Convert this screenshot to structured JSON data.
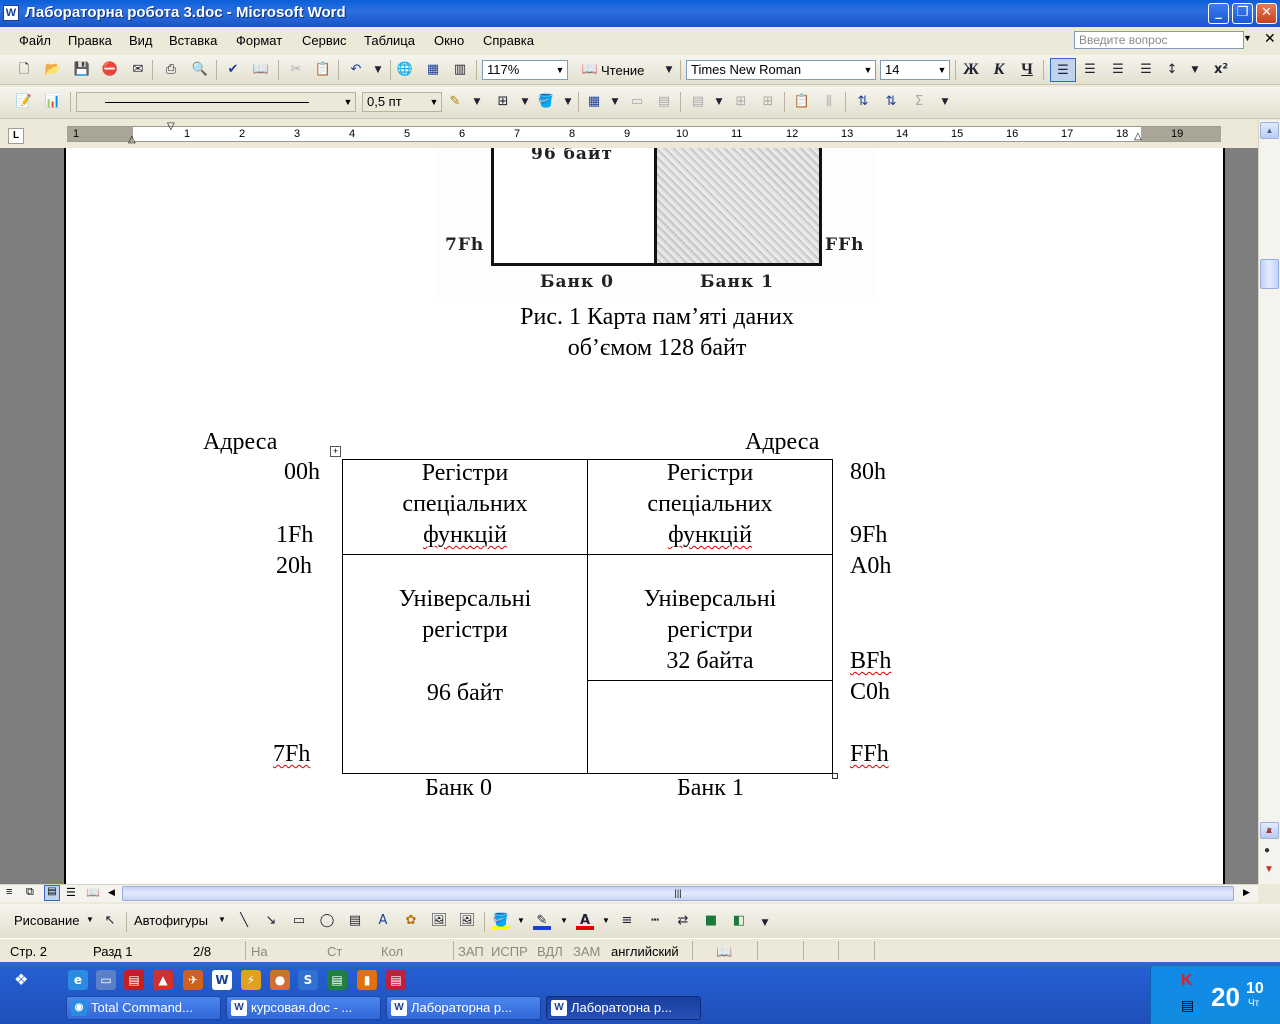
{
  "window": {
    "title": "Лабораторна робота 3.doc - Microsoft Word",
    "minimize_label": "_",
    "restore_label": "❐",
    "close_label": "✕",
    "doc_close_label": "✕"
  },
  "menubar": {
    "items": [
      "Файл",
      "Правка",
      "Вид",
      "Вставка",
      "Формат",
      "Сервис",
      "Таблица",
      "Окно",
      "Справка"
    ],
    "ask_placeholder": "Введите вопрос"
  },
  "toolbar_standard": {
    "zoom": "117%",
    "reading_label": "Чтение",
    "font_name": "Times New Roman",
    "font_size": "14",
    "bold_label": "Ж",
    "italic_label": "К",
    "underline_label": "Ч"
  },
  "toolbar_tables": {
    "line_weight": "0,5 пт"
  },
  "ruler": {
    "numbers": [
      "1",
      "1",
      "2",
      "3",
      "4",
      "5",
      "6",
      "7",
      "8",
      "9",
      "10",
      "11",
      "12",
      "13",
      "14",
      "15",
      "16",
      "17",
      "18",
      "19"
    ],
    "tab_selector": "L"
  },
  "document": {
    "scan_figure": {
      "label_96": "96 байт",
      "addr_7f": "7Fh",
      "addr_ff": "FFh",
      "bank0": "Банк 0",
      "bank1": "Банк 1"
    },
    "caption_line1": "Рис. 1 Карта пам’яті даних",
    "caption_line2": "об’ємом 128 байт",
    "diagram": {
      "addresses_left_header": "Адреса",
      "addresses_right_header": "Адреса",
      "left_addrs": [
        "00h",
        "1Fh",
        "20h",
        "7Fh"
      ],
      "right_addrs": [
        "80h",
        "9Fh",
        "A0h",
        "BFh",
        "C0h",
        "FFh"
      ],
      "sfr_bank0": [
        "Регістри",
        "спеціальних",
        "функцій"
      ],
      "sfr_bank1": [
        "Регістри",
        "спеціальних",
        "функцій"
      ],
      "gpr_bank0": [
        "Універсальні",
        "регістри",
        "96 байт"
      ],
      "gpr_bank1": [
        "Універсальні",
        "регістри",
        "32 байта"
      ],
      "bank0_label": "Банк 0",
      "bank1_label": "Банк 1"
    }
  },
  "drawing_toolbar": {
    "drawing_label": "Рисование",
    "autoshapes_label": "Автофигуры"
  },
  "statusbar": {
    "page": "Стр. 2",
    "section": "Разд 1",
    "page_of": "2/8",
    "at": "На",
    "line": "Ст",
    "col": "Кол",
    "rec": "ЗАП",
    "trk": "ИСПР",
    "ext": "ВДЛ",
    "ovr": "ЗАМ",
    "language": "английский"
  },
  "taskbar": {
    "buttons": [
      "Total Command...",
      "курсовая.doc - ...",
      "Лабораторна р...",
      "Лабораторна р..."
    ],
    "clock_big": "20",
    "clock_small": "10",
    "clock_day": "Чт"
  },
  "colors": {
    "titlebar": "#0a5fd8",
    "taskbar": "#245fd2",
    "tray": "#0f8ae8",
    "spellcheck": "#e00000"
  }
}
